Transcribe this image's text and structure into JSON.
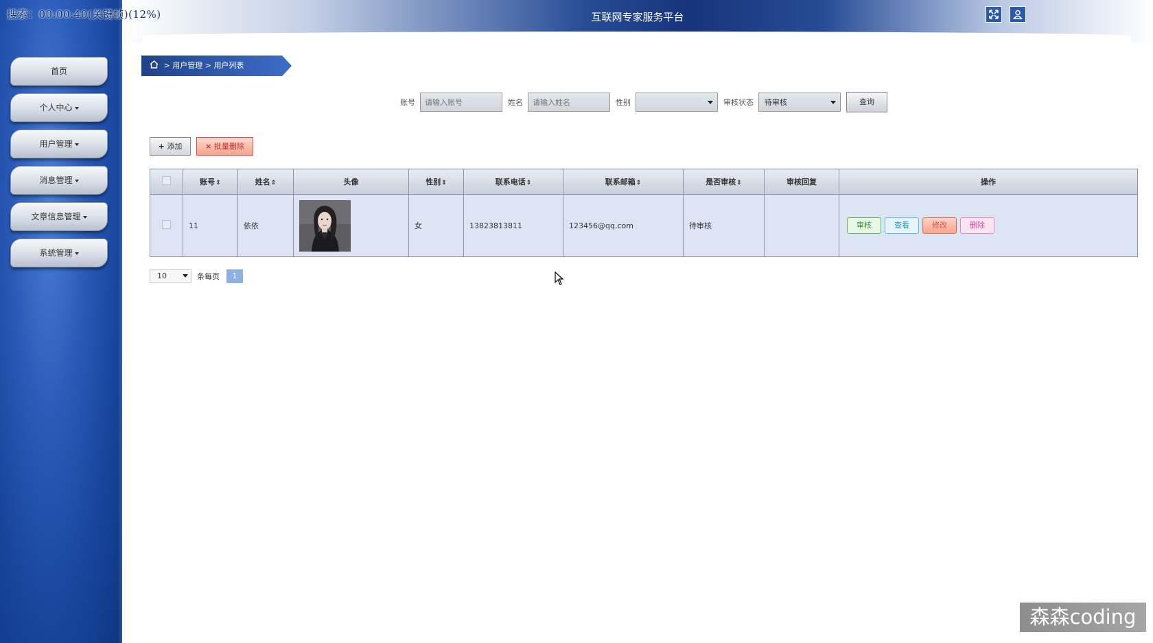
{
  "timer": "搜索：00:00:40(关键帧)(12%)",
  "header": {
    "title": "互联网专家服务平台"
  },
  "header_icons": [
    "fullscreen-icon",
    "user-icon"
  ],
  "nav": [
    {
      "label": "首页",
      "dropdown": false
    },
    {
      "label": "个人中心",
      "dropdown": true
    },
    {
      "label": "用户管理",
      "dropdown": true
    },
    {
      "label": "消息管理",
      "dropdown": true
    },
    {
      "label": "文章信息管理",
      "dropdown": true
    },
    {
      "label": "系统管理",
      "dropdown": true
    }
  ],
  "breadcrumb": {
    "sep": ">",
    "items": [
      "用户管理",
      "用户列表"
    ]
  },
  "search": {
    "account_label": "账号",
    "account_placeholder": "请输入账号",
    "name_label": "姓名",
    "name_placeholder": "请输入姓名",
    "gender_label": "性别",
    "gender_value": "",
    "status_label": "审核状态",
    "status_value": "待审核",
    "query_button": "查询"
  },
  "actions": {
    "add": "添加",
    "batch_delete": "批量删除"
  },
  "table": {
    "headers": [
      "账号",
      "姓名",
      "头像",
      "性别",
      "联系电话",
      "联系邮箱",
      "是否审核",
      "审核回复",
      "操作"
    ],
    "rows": [
      {
        "account": "11",
        "name": "依依",
        "gender": "女",
        "phone": "13823813811",
        "email": "123456@qq.com",
        "audit": "待审核",
        "reply": "",
        "ops": [
          "审核",
          "查看",
          "修改",
          "删除"
        ]
      }
    ]
  },
  "pager": {
    "per_page": "10",
    "per_page_label": "条每页",
    "current": "1"
  },
  "watermark": "森森coding"
}
